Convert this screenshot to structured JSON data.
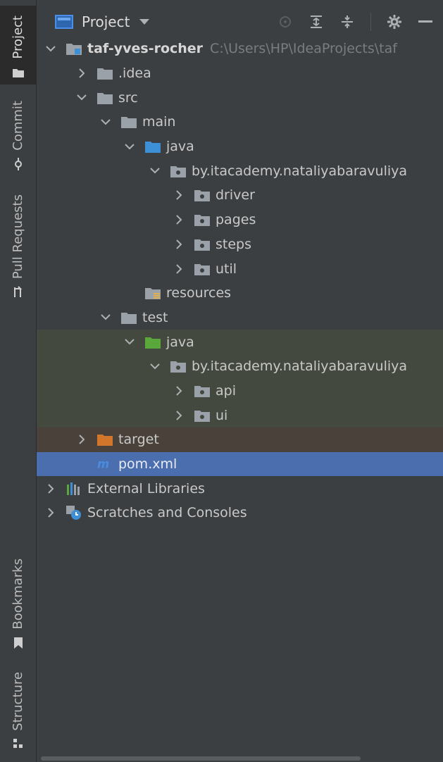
{
  "sidebar": {
    "tabs": [
      {
        "label": "Project",
        "icon": "folder-icon"
      },
      {
        "label": "Commit",
        "icon": "commit-icon"
      },
      {
        "label": "Pull Requests",
        "icon": "pull-request-icon"
      },
      {
        "label": "Bookmarks",
        "icon": "bookmark-icon"
      },
      {
        "label": "Structure",
        "icon": "structure-icon"
      }
    ]
  },
  "header": {
    "title": "Project",
    "tools": [
      "locate-icon",
      "expand-all-icon",
      "collapse-all-icon",
      "gear-icon",
      "minimize-icon"
    ]
  },
  "tree": {
    "root_name": "taf-yves-rocher",
    "root_path": "C:\\Users\\HP\\IdeaProjects\\taf",
    "idea": ".idea",
    "src": "src",
    "main": "main",
    "main_java": "java",
    "main_package": "by.itacademy.nataliyabaravuliya",
    "driver": "driver",
    "pages": "pages",
    "steps": "steps",
    "util": "util",
    "resources": "resources",
    "test": "test",
    "test_java": "java",
    "test_package": "by.itacademy.nataliyabaravuliya",
    "api": "api",
    "ui": "ui",
    "target": "target",
    "pom": "pom.xml",
    "external_libraries": "External Libraries",
    "scratches": "Scratches and Consoles"
  },
  "colors": {
    "background": "#3c3f41",
    "selected_row": "#4b6eaf",
    "test_tint": "#44493f",
    "target_tint": "#4a423a",
    "folder_gray": "#9aa1a8",
    "folder_blue": "#3d8fd6",
    "folder_green": "#5aa83c",
    "folder_orange": "#d1762a",
    "maven_blue": "#4a8ce0"
  }
}
